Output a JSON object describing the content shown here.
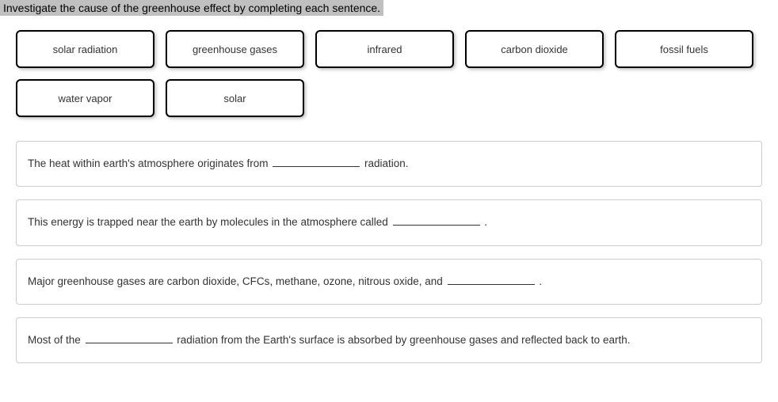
{
  "instruction": "Investigate the cause of the greenhouse effect by completing each sentence.",
  "tiles": {
    "t0": "solar radiation",
    "t1": "greenhouse gases",
    "t2": "infrared",
    "t3": "carbon dioxide",
    "t4": "fossil fuels",
    "t5": "water vapor",
    "t6": "solar"
  },
  "sentences": {
    "s0": {
      "p0": "The heat within earth's atmosphere originates from ",
      "p1": " radiation."
    },
    "s1": {
      "p0": "This energy is trapped near the earth by molecules in the atmosphere called ",
      "p1": " ."
    },
    "s2": {
      "p0": "Major greenhouse gases are carbon dioxide, CFCs, methane, ozone, nitrous oxide, and ",
      "p1": " ."
    },
    "s3": {
      "p0": "Most of the ",
      "p1": " radiation from the Earth's surface is absorbed by greenhouse gases and reflected back to earth."
    }
  }
}
